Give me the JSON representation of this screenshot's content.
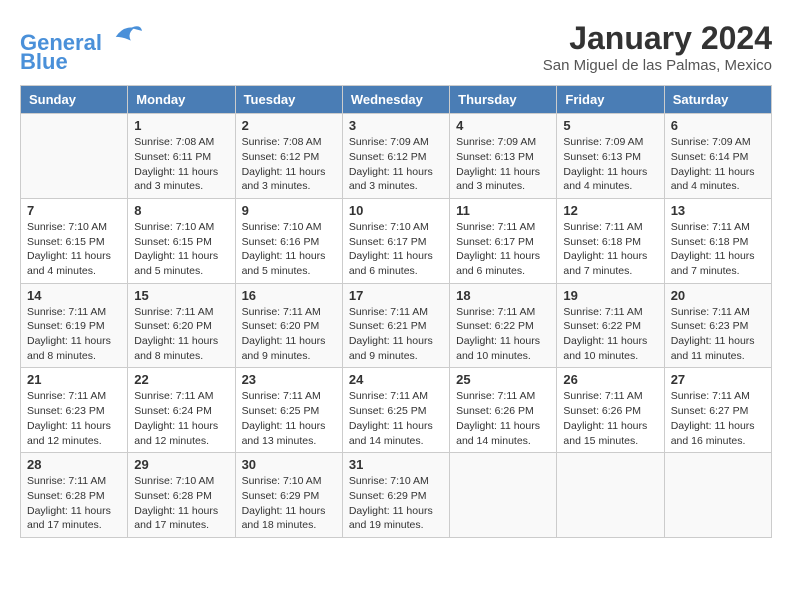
{
  "header": {
    "logo_line1": "General",
    "logo_line2": "Blue",
    "month_title": "January 2024",
    "location": "San Miguel de las Palmas, Mexico"
  },
  "days_of_week": [
    "Sunday",
    "Monday",
    "Tuesday",
    "Wednesday",
    "Thursday",
    "Friday",
    "Saturday"
  ],
  "weeks": [
    [
      {
        "day": "",
        "sunrise": "",
        "sunset": "",
        "daylight": ""
      },
      {
        "day": "1",
        "sunrise": "Sunrise: 7:08 AM",
        "sunset": "Sunset: 6:11 PM",
        "daylight": "Daylight: 11 hours and 3 minutes."
      },
      {
        "day": "2",
        "sunrise": "Sunrise: 7:08 AM",
        "sunset": "Sunset: 6:12 PM",
        "daylight": "Daylight: 11 hours and 3 minutes."
      },
      {
        "day": "3",
        "sunrise": "Sunrise: 7:09 AM",
        "sunset": "Sunset: 6:12 PM",
        "daylight": "Daylight: 11 hours and 3 minutes."
      },
      {
        "day": "4",
        "sunrise": "Sunrise: 7:09 AM",
        "sunset": "Sunset: 6:13 PM",
        "daylight": "Daylight: 11 hours and 3 minutes."
      },
      {
        "day": "5",
        "sunrise": "Sunrise: 7:09 AM",
        "sunset": "Sunset: 6:13 PM",
        "daylight": "Daylight: 11 hours and 4 minutes."
      },
      {
        "day": "6",
        "sunrise": "Sunrise: 7:09 AM",
        "sunset": "Sunset: 6:14 PM",
        "daylight": "Daylight: 11 hours and 4 minutes."
      }
    ],
    [
      {
        "day": "7",
        "sunrise": "Sunrise: 7:10 AM",
        "sunset": "Sunset: 6:15 PM",
        "daylight": "Daylight: 11 hours and 4 minutes."
      },
      {
        "day": "8",
        "sunrise": "Sunrise: 7:10 AM",
        "sunset": "Sunset: 6:15 PM",
        "daylight": "Daylight: 11 hours and 5 minutes."
      },
      {
        "day": "9",
        "sunrise": "Sunrise: 7:10 AM",
        "sunset": "Sunset: 6:16 PM",
        "daylight": "Daylight: 11 hours and 5 minutes."
      },
      {
        "day": "10",
        "sunrise": "Sunrise: 7:10 AM",
        "sunset": "Sunset: 6:17 PM",
        "daylight": "Daylight: 11 hours and 6 minutes."
      },
      {
        "day": "11",
        "sunrise": "Sunrise: 7:11 AM",
        "sunset": "Sunset: 6:17 PM",
        "daylight": "Daylight: 11 hours and 6 minutes."
      },
      {
        "day": "12",
        "sunrise": "Sunrise: 7:11 AM",
        "sunset": "Sunset: 6:18 PM",
        "daylight": "Daylight: 11 hours and 7 minutes."
      },
      {
        "day": "13",
        "sunrise": "Sunrise: 7:11 AM",
        "sunset": "Sunset: 6:18 PM",
        "daylight": "Daylight: 11 hours and 7 minutes."
      }
    ],
    [
      {
        "day": "14",
        "sunrise": "Sunrise: 7:11 AM",
        "sunset": "Sunset: 6:19 PM",
        "daylight": "Daylight: 11 hours and 8 minutes."
      },
      {
        "day": "15",
        "sunrise": "Sunrise: 7:11 AM",
        "sunset": "Sunset: 6:20 PM",
        "daylight": "Daylight: 11 hours and 8 minutes."
      },
      {
        "day": "16",
        "sunrise": "Sunrise: 7:11 AM",
        "sunset": "Sunset: 6:20 PM",
        "daylight": "Daylight: 11 hours and 9 minutes."
      },
      {
        "day": "17",
        "sunrise": "Sunrise: 7:11 AM",
        "sunset": "Sunset: 6:21 PM",
        "daylight": "Daylight: 11 hours and 9 minutes."
      },
      {
        "day": "18",
        "sunrise": "Sunrise: 7:11 AM",
        "sunset": "Sunset: 6:22 PM",
        "daylight": "Daylight: 11 hours and 10 minutes."
      },
      {
        "day": "19",
        "sunrise": "Sunrise: 7:11 AM",
        "sunset": "Sunset: 6:22 PM",
        "daylight": "Daylight: 11 hours and 10 minutes."
      },
      {
        "day": "20",
        "sunrise": "Sunrise: 7:11 AM",
        "sunset": "Sunset: 6:23 PM",
        "daylight": "Daylight: 11 hours and 11 minutes."
      }
    ],
    [
      {
        "day": "21",
        "sunrise": "Sunrise: 7:11 AM",
        "sunset": "Sunset: 6:23 PM",
        "daylight": "Daylight: 11 hours and 12 minutes."
      },
      {
        "day": "22",
        "sunrise": "Sunrise: 7:11 AM",
        "sunset": "Sunset: 6:24 PM",
        "daylight": "Daylight: 11 hours and 12 minutes."
      },
      {
        "day": "23",
        "sunrise": "Sunrise: 7:11 AM",
        "sunset": "Sunset: 6:25 PM",
        "daylight": "Daylight: 11 hours and 13 minutes."
      },
      {
        "day": "24",
        "sunrise": "Sunrise: 7:11 AM",
        "sunset": "Sunset: 6:25 PM",
        "daylight": "Daylight: 11 hours and 14 minutes."
      },
      {
        "day": "25",
        "sunrise": "Sunrise: 7:11 AM",
        "sunset": "Sunset: 6:26 PM",
        "daylight": "Daylight: 11 hours and 14 minutes."
      },
      {
        "day": "26",
        "sunrise": "Sunrise: 7:11 AM",
        "sunset": "Sunset: 6:26 PM",
        "daylight": "Daylight: 11 hours and 15 minutes."
      },
      {
        "day": "27",
        "sunrise": "Sunrise: 7:11 AM",
        "sunset": "Sunset: 6:27 PM",
        "daylight": "Daylight: 11 hours and 16 minutes."
      }
    ],
    [
      {
        "day": "28",
        "sunrise": "Sunrise: 7:11 AM",
        "sunset": "Sunset: 6:28 PM",
        "daylight": "Daylight: 11 hours and 17 minutes."
      },
      {
        "day": "29",
        "sunrise": "Sunrise: 7:10 AM",
        "sunset": "Sunset: 6:28 PM",
        "daylight": "Daylight: 11 hours and 17 minutes."
      },
      {
        "day": "30",
        "sunrise": "Sunrise: 7:10 AM",
        "sunset": "Sunset: 6:29 PM",
        "daylight": "Daylight: 11 hours and 18 minutes."
      },
      {
        "day": "31",
        "sunrise": "Sunrise: 7:10 AM",
        "sunset": "Sunset: 6:29 PM",
        "daylight": "Daylight: 11 hours and 19 minutes."
      },
      {
        "day": "",
        "sunrise": "",
        "sunset": "",
        "daylight": ""
      },
      {
        "day": "",
        "sunrise": "",
        "sunset": "",
        "daylight": ""
      },
      {
        "day": "",
        "sunrise": "",
        "sunset": "",
        "daylight": ""
      }
    ]
  ]
}
